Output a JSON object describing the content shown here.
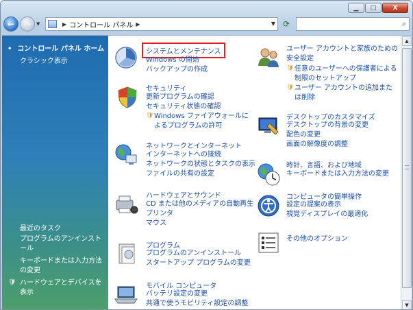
{
  "window": {
    "min_label": "▁",
    "max_label": "□",
    "close_label": "X"
  },
  "addressbar": {
    "path": "コントロール パネル",
    "search_placeholder": ""
  },
  "leftpanel": {
    "home": "コントロール パネル ホーム",
    "classic": "クラシック表示",
    "recent_tasks_title": "最近のタスク",
    "tasks": [
      "プログラムのアンインストール",
      "キーボードまたは入力方法の変更",
      "ハードウェアとデバイスを表示"
    ]
  },
  "categories": {
    "system": {
      "title": "システムとメンテナンス",
      "links": [
        "Windows の開始",
        "バックアップの作成"
      ]
    },
    "security": {
      "title": "セキュリティ",
      "links": [
        "更新プログラムの確認",
        "セキュリティ状態の確認",
        "Windows ファイアウォールによるプログラムの許可"
      ]
    },
    "network": {
      "title": "ネットワークとインターネット",
      "links": [
        "インターネットへの接続",
        "ネットワークの状態とタスクの表示",
        "ファイルの共有の設定"
      ]
    },
    "hardware": {
      "title": "ハードウェアとサウンド",
      "links": [
        "CD または他のメディアの自動再生",
        "プリンタ",
        "マウス"
      ]
    },
    "programs": {
      "title": "プログラム",
      "links": [
        "プログラムのアンインストール",
        "スタートアップ プログラムの変更"
      ]
    },
    "mobile": {
      "title": "モバイル コンピュータ",
      "links": [
        "バッテリ設定の変更",
        "共通で使うモビリティ設定の調整"
      ]
    },
    "users": {
      "title": "ユーザー アカウントと家族のための安全設定",
      "links": [
        "任意のユーザーへの保護者による制限のセットアップ",
        "ユーザー アカウントの追加または削除"
      ]
    },
    "appearance": {
      "title": "デスクトップのカスタマイズ",
      "links": [
        "デスクトップの背景の変更",
        "配色の変更",
        "画面の解像度の調整"
      ]
    },
    "clock": {
      "title": "時計、言語、および地域",
      "links": [
        "キーボードまたは入力方法の変更"
      ]
    },
    "ease": {
      "title": "コンピュータの簡単操作",
      "links": [
        "設定の提案の表示",
        "視覚ディスプレイの最適化"
      ]
    },
    "other": {
      "title": "その他のオプション"
    }
  }
}
